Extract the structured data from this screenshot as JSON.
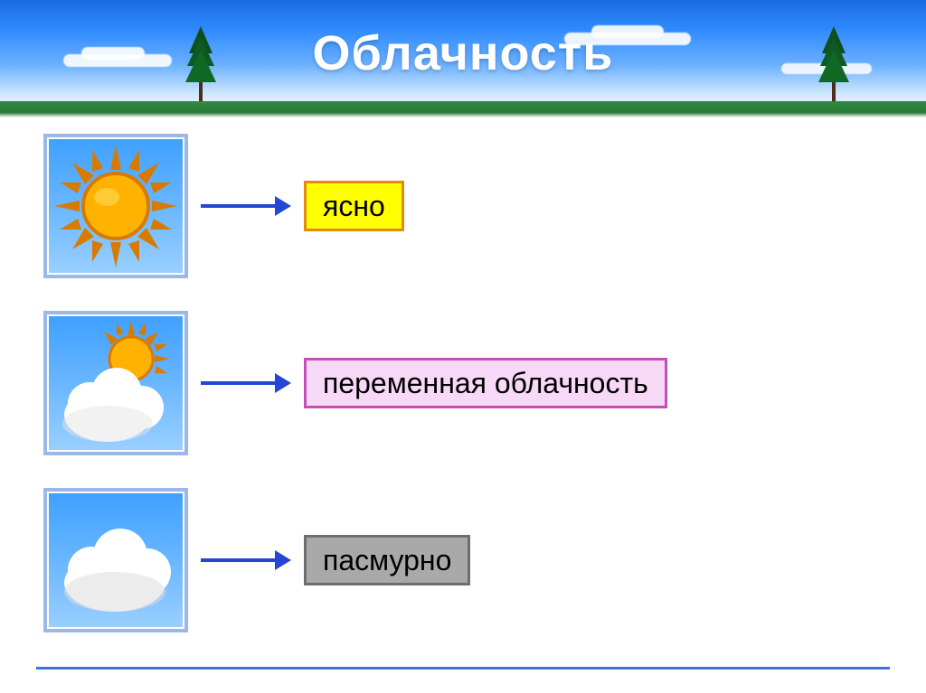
{
  "title": "Облачность",
  "rows": [
    {
      "icon": "sun",
      "label": "ясно",
      "label_class": "clear"
    },
    {
      "icon": "sun-cloud",
      "label": "переменная облачность",
      "label_class": "partly"
    },
    {
      "icon": "cloud",
      "label": "пасмурно",
      "label_class": "overcast"
    }
  ]
}
